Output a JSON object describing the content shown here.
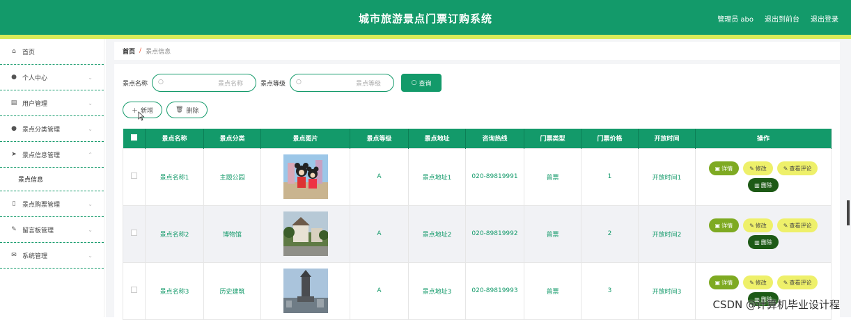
{
  "header": {
    "title": "城市旅游景点门票订购系统",
    "admin_label": "管理员 abo",
    "front_label": "退出到前台",
    "logout_label": "退出登录"
  },
  "sidebar": {
    "items": [
      {
        "label": "首页",
        "icon": "home-icon"
      },
      {
        "label": "个人中心",
        "icon": "user-icon"
      },
      {
        "label": "用户管理",
        "icon": "clipboard-icon"
      },
      {
        "label": "景点分类管理",
        "icon": "user-icon"
      },
      {
        "label": "景点信息管理",
        "icon": "send-icon"
      },
      {
        "label": "景点信息",
        "icon": ""
      },
      {
        "label": "景点购票管理",
        "icon": "ticket-icon"
      },
      {
        "label": "留言板管理",
        "icon": "edit-icon"
      },
      {
        "label": "系统管理",
        "icon": "mail-icon"
      }
    ]
  },
  "breadcrumb": {
    "home": "首页",
    "sep": "/",
    "current": "景点信息"
  },
  "search": {
    "name_label": "景点名称",
    "name_placeholder": "景点名称",
    "level_label": "景点等级",
    "level_placeholder": "景点等级",
    "button": "查询"
  },
  "actions": {
    "add": "新增",
    "delete": "删除"
  },
  "table": {
    "headers": [
      "景点名称",
      "景点分类",
      "景点图片",
      "景点等级",
      "景点地址",
      "咨询热线",
      "门票类型",
      "门票价格",
      "开放时间",
      "操作"
    ],
    "rows": [
      {
        "name": "景点名称1",
        "category": "主题公园",
        "level": "A",
        "address": "景点地址1",
        "phone": "020-89819991",
        "ticket_type": "普票",
        "price": "1",
        "open": "开放时间1"
      },
      {
        "name": "景点名称2",
        "category": "博物馆",
        "level": "A",
        "address": "景点地址2",
        "phone": "020-89819992",
        "ticket_type": "普票",
        "price": "2",
        "open": "开放时间2"
      },
      {
        "name": "景点名称3",
        "category": "历史建筑",
        "level": "A",
        "address": "景点地址3",
        "phone": "020-89819993",
        "ticket_type": "普票",
        "price": "3",
        "open": "开放时间3"
      }
    ],
    "ops": {
      "detail": "详情",
      "edit": "修改",
      "review": "查看评论",
      "delete": "删除"
    }
  },
  "watermark": "CSDN @计算机毕业设计程",
  "colors": {
    "primary": "#139a6a",
    "accent_strip": "#d8ea5a",
    "detail_btn": "#7eaa22",
    "edit_btn": "#eef06a",
    "delete_btn": "#1d5a16"
  }
}
